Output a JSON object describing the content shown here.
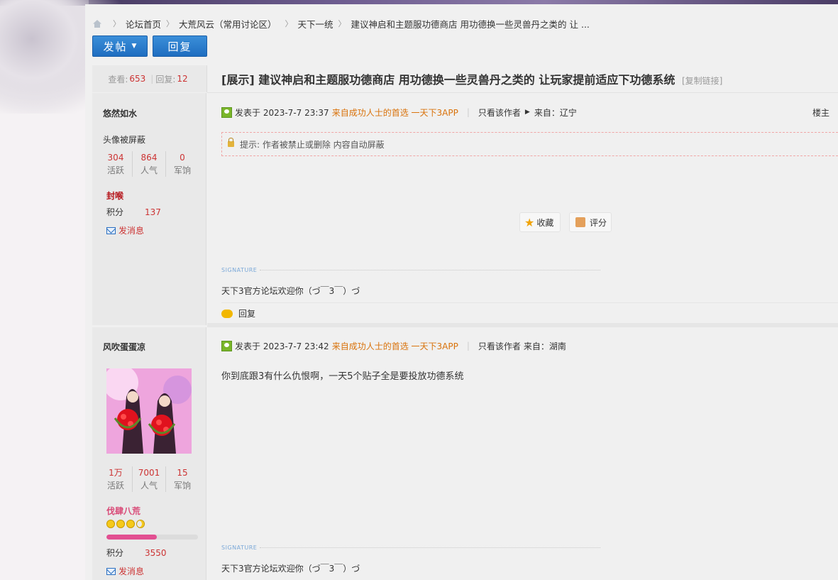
{
  "breadcrumb": [
    {
      "label": "论坛首页"
    },
    {
      "label": "大荒风云（常用讨论区）"
    },
    {
      "label": "天下一统"
    },
    {
      "label": "建议神启和主题服功德商店 用功德换一些灵兽丹之类的 让 ..."
    }
  ],
  "toolbar": {
    "post_label": "发帖",
    "reply_label": "回复"
  },
  "thread": {
    "views_label": "查看:",
    "views": "653",
    "replies_label": "回复:",
    "replies": "12",
    "tag": "[展示]",
    "title": "建议神启和主题服功德商店 用功德换一些灵兽丹之类的 让玩家提前适应下功德系统",
    "copy_link": "[复制链接]"
  },
  "posts": [
    {
      "author": "悠然如水",
      "avatar_hidden": "头像被屏蔽",
      "stats": [
        {
          "value": "304",
          "label": "活跃"
        },
        {
          "value": "864",
          "label": "人气"
        },
        {
          "value": "0",
          "label": "军饷"
        }
      ],
      "rank": "封喉",
      "rank_color": "#b5151b",
      "points_label": "积分",
      "points": "137",
      "message_label": "发消息",
      "posted_at": "发表于 2023-7-7 23:37",
      "app_label": "来自成功人士的首选 一天下3APP",
      "only_author": "只看该作者",
      "from": "来自：辽宁",
      "floor": "楼主",
      "notice": "提示: 作者被禁止或删除 内容自动屏蔽",
      "actions": {
        "favorite": "收藏",
        "rate": "评分"
      },
      "signature_label": "SIGNATURE",
      "signature": "天下3官方论坛欢迎你（づ￣3￣）づ",
      "reply": "回复"
    },
    {
      "author": "风吹蛋蛋凉",
      "stats": [
        {
          "value": "1万",
          "label": "活跃"
        },
        {
          "value": "7001",
          "label": "人气"
        },
        {
          "value": "15",
          "label": "军饷"
        }
      ],
      "rank": "伐肆八荒",
      "rank_color": "#d94b78",
      "level_progress": 0.55,
      "points_label": "积分",
      "points": "3550",
      "message_label": "发消息",
      "posted_at": "发表于 2023-7-7 23:42",
      "app_label": "来自成功人士的首选 一天下3APP",
      "only_author": "只看该作者",
      "from": "来自：湖南",
      "content": "你到底跟3有什么仇恨啊，一天5个贴子全是要投放功德系统",
      "signature_label": "SIGNATURE",
      "signature": "天下3官方论坛欢迎你（づ￣3￣）づ"
    }
  ],
  "colors": {
    "accent_blue": "#1e6dc0",
    "stat_red": "#cc3333",
    "app_orange": "#d9720b"
  }
}
